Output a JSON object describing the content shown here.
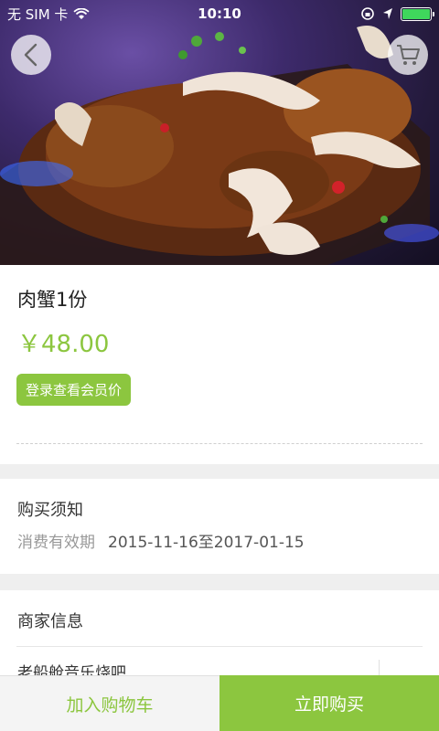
{
  "status_bar": {
    "carrier": "无 SIM 卡",
    "time": "10:10",
    "battery_color": "#3fd75c"
  },
  "hero": {
    "back_icon": "chevron-left-icon",
    "cart_icon": "cart-icon"
  },
  "product": {
    "name": "肉蟹1份",
    "price": "￥48.00",
    "member_button": "登录查看会员价"
  },
  "purchase_notice": {
    "title": "购买须知",
    "validity_label": "消费有效期",
    "validity_value": "2015-11-16至2017-01-15"
  },
  "merchant": {
    "title": "商家信息",
    "shop_name": "老船舱音乐烧吧"
  },
  "bottom_bar": {
    "add_to_cart": "加入购物车",
    "buy_now": "立即购买"
  },
  "colors": {
    "accent": "#8cc63f",
    "background": "#efefef"
  }
}
